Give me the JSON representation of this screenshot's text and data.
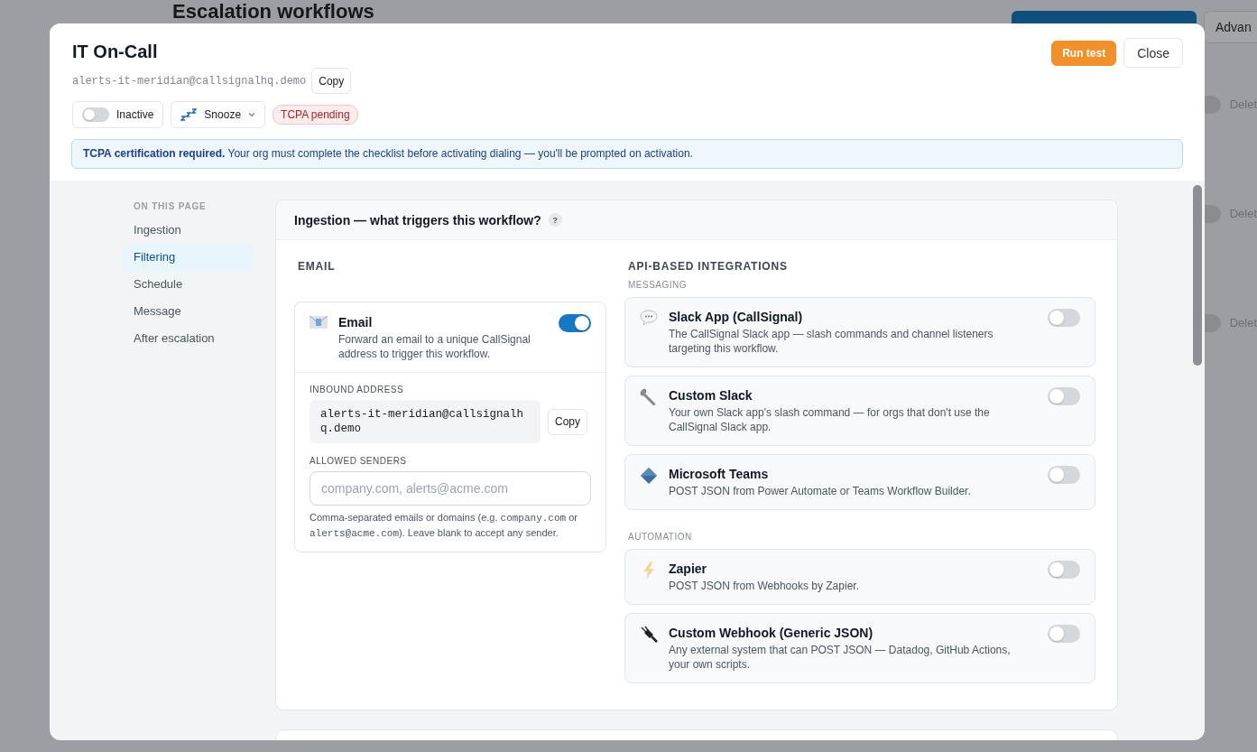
{
  "background_page": {
    "title": "Escalation workflows",
    "advanced_button": "Advan",
    "rows": [
      {
        "on": false,
        "action": "Delet"
      },
      {
        "on": false,
        "action": "Delet"
      },
      {
        "on": false,
        "action": "Delet"
      }
    ]
  },
  "dialog": {
    "title": "IT On-Call",
    "address": "alerts-it-meridian@callsignalhq.demo",
    "copy_label": "Copy",
    "run_test": "Run test",
    "close": "Close",
    "status_toggle": {
      "label": "Inactive",
      "on": false
    },
    "snooze": {
      "label": "Snooze"
    },
    "badge": "TCPA pending",
    "notice": "**TCPA certification required.** Your org must complete the checklist before activating dialing — you'll be prompted on activation.",
    "nav": {
      "heading": "ON THIS PAGE",
      "items": [
        {
          "label": "Ingestion",
          "selected": false
        },
        {
          "label": "Filtering",
          "selected": true
        },
        {
          "label": "Schedule",
          "selected": false
        },
        {
          "label": "Message",
          "selected": false
        },
        {
          "label": "After escalation",
          "selected": false
        }
      ]
    },
    "ingestion": {
      "title": "Ingestion — what triggers this workflow?",
      "help": "?",
      "email_heading": "EMAIL",
      "email": {
        "title": "Email",
        "description": "Forward an email to a unique CallSignal address to trigger this workflow.",
        "on": true,
        "inbound_label": "INBOUND ADDRESS",
        "inbound_address": "alerts-it-meridian@callsignalhq.demo",
        "copy_label": "Copy",
        "senders_label": "ALLOWED SENDERS",
        "senders_placeholder": "company.com, alerts@acme.com",
        "hint": [
          {
            "kind": "text",
            "text": "Comma-separated emails or domains (e.g. "
          },
          {
            "kind": "code",
            "text": "company.com"
          },
          {
            "kind": "text",
            "text": " or "
          },
          {
            "kind": "code",
            "text": "alerts@acme.com"
          },
          {
            "kind": "text",
            "text": "). Leave blank to accept any sender."
          }
        ]
      },
      "api_heading": "API-BASED INTEGRATIONS",
      "groups": [
        {
          "label": "MESSAGING",
          "items": [
            {
              "kind": "chat",
              "title": "Slack App (CallSignal)",
              "description": "The CallSignal Slack app — slash commands and channel listeners targeting this workflow.",
              "on": false
            },
            {
              "kind": "wrench",
              "title": "Custom Slack",
              "description": "Your own Slack app's slash command — for orgs that don't use the CallSignal Slack app.",
              "on": false
            },
            {
              "kind": "diamond",
              "title": "Microsoft Teams",
              "description": "POST JSON from Power Automate or Teams Workflow Builder.",
              "on": false
            }
          ]
        },
        {
          "label": "AUTOMATION",
          "items": [
            {
              "kind": "bolt",
              "title": "Zapier",
              "description": "POST JSON from Webhooks by Zapier.",
              "on": false
            },
            {
              "kind": "plug",
              "title": "Custom Webhook (Generic JSON)",
              "description": "Any external system that can POST JSON — Datadog, GitHub Actions, your own scripts.",
              "on": false
            }
          ]
        }
      ]
    }
  }
}
